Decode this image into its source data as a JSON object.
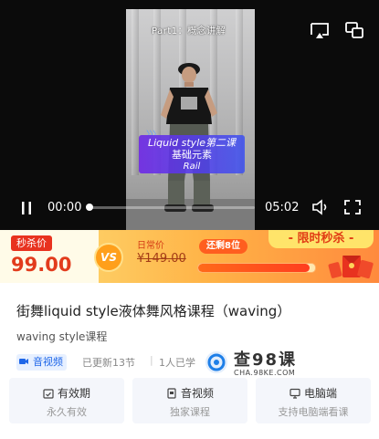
{
  "player": {
    "part_title": "Part1：概念讲解",
    "promo": {
      "deco": "〉〉〉",
      "line1": "Liquid style第二课",
      "line2": "基础元素",
      "line3": "Rail"
    },
    "current_time": "00:00",
    "duration": "05:02",
    "progress_fraction": 0.0
  },
  "price_banner": {
    "seckill_label": "秒杀价",
    "seckill_price": "99.00",
    "vs_label": "VS",
    "original_label": "日常价",
    "original_price": "¥149.00",
    "remaining_label": "还剩8位",
    "remaining_fraction": 0.95,
    "limited_label": "- 限时秒杀 -"
  },
  "course": {
    "title": "街舞liquid style液体舞风格课程（waving）",
    "subtitle": "waving style课程",
    "audio_tag": "音视频",
    "updated": "已更新13节",
    "learners": "1人已学",
    "watermark_text": "查98课",
    "watermark_url": "CHA.98KE.COM"
  },
  "features": [
    {
      "title": "有效期",
      "sub": "永久有效",
      "icon": "calendar-check-icon"
    },
    {
      "title": "音视频",
      "sub": "独家课程",
      "icon": "document-icon"
    },
    {
      "title": "电脑端",
      "sub": "支持电脑端看课",
      "icon": "monitor-icon"
    }
  ],
  "colors": {
    "accent_red": "#e23b1c",
    "link_blue": "#1e66e8",
    "banner_yellow": "#fde27a",
    "banner_orange": "#ff8a3d"
  }
}
